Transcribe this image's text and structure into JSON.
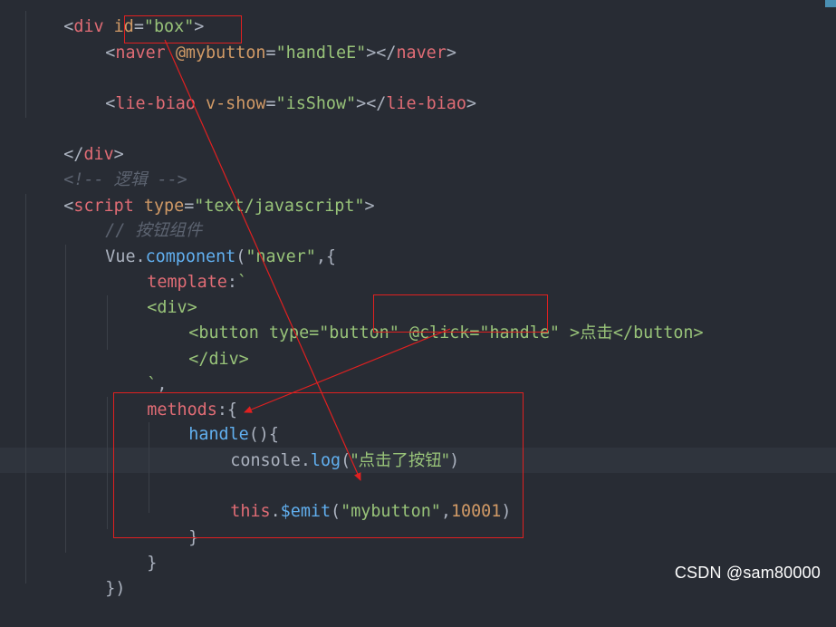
{
  "code": {
    "line1": {
      "a": "<",
      "b": "div",
      "c": " ",
      "d": "id",
      "e": "=",
      "f": "\"box\"",
      "g": ">"
    },
    "line2": {
      "a": "<",
      "b": "naver",
      "c": " ",
      "d": "@mybutton",
      "e": "=",
      "f": "\"handleE\"",
      "g": "></",
      "h": "naver",
      "i": ">"
    },
    "line3": {
      "a": "<",
      "b": "lie-biao",
      "c": " ",
      "d": "v-show",
      "e": "=",
      "f": "\"isShow\"",
      "g": "></",
      "h": "lie-biao",
      "i": ">"
    },
    "line4": {
      "a": "</",
      "b": "div",
      "c": ">"
    },
    "line5": {
      "a": "<!-- ",
      "b": "逻辑",
      "c": " -->"
    },
    "line6": {
      "a": "<",
      "b": "script",
      "c": " ",
      "d": "type",
      "e": "=",
      "f": "\"text/javascript\"",
      "g": ">"
    },
    "line7": {
      "a": "// ",
      "b": "按钮组件"
    },
    "line8": {
      "a": "Vue",
      "b": ".",
      "c": "component",
      "d": "(",
      "e": "\"naver\"",
      "f": ",{"
    },
    "line9": {
      "a": "template",
      "b": ":",
      "c": "`"
    },
    "line10": {
      "a": "<div>"
    },
    "line11": {
      "a": "<button type=\"button\" ",
      "b": "@click=\"handle\" ",
      "c": ">",
      "d": "点击",
      "e": "</button>"
    },
    "line12": {
      "a": "</div>"
    },
    "line13": {
      "a": "`",
      "b": ","
    },
    "line14": {
      "a": "methods",
      "b": ":",
      "c": "{"
    },
    "line15": {
      "a": "handle",
      "b": "()",
      "c": "{"
    },
    "line16": {
      "a": "console",
      "b": ".",
      "c": "log",
      "d": "(",
      "e": "\"点击了按钮\"",
      "f": ")"
    },
    "line17": {
      "a": "this",
      "b": ".",
      "c": "$emit",
      "d": "(",
      "e": "\"mybutton\"",
      "f": ",",
      "g": "10001",
      "h": ")"
    },
    "line18": {
      "a": "}"
    },
    "line19": {
      "a": "}"
    },
    "line20": {
      "a": "})"
    }
  },
  "watermark": "CSDN @sam80000",
  "colors": {
    "background": "#282c34",
    "tag": "#e06c75",
    "attribute": "#d19a66",
    "string": "#98c379",
    "comment": "#5c6370",
    "function": "#61afef",
    "annotation": "#e02020"
  }
}
